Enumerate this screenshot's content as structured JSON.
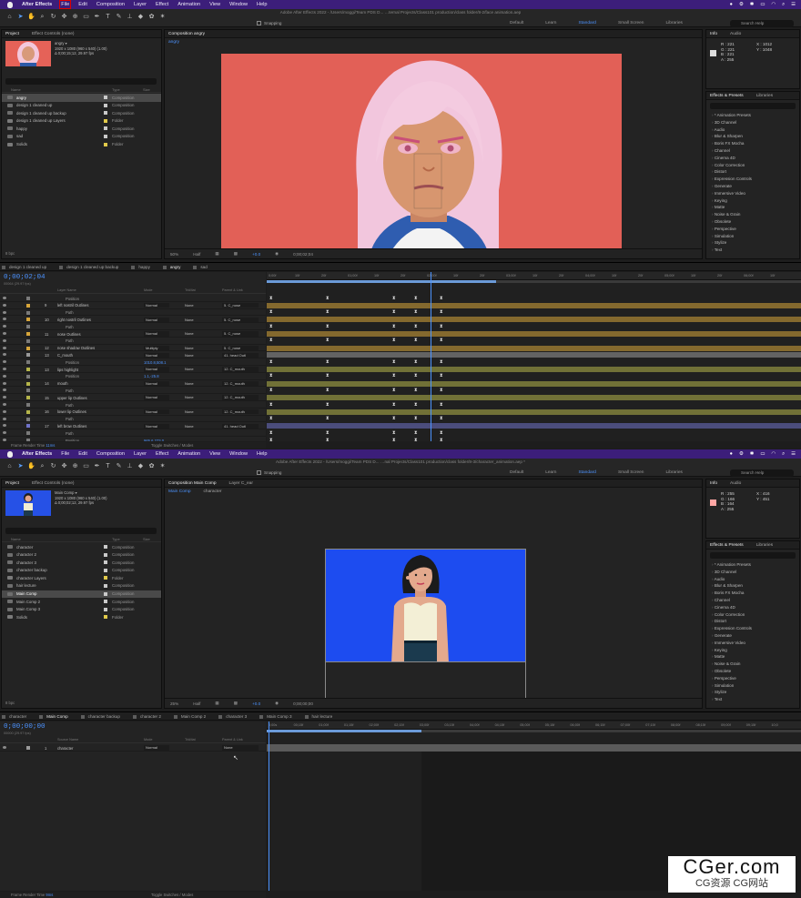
{
  "window1": {
    "menu": [
      "After Effects",
      "File",
      "Edit",
      "Composition",
      "Layer",
      "Effect",
      "Animation",
      "View",
      "Window",
      "Help"
    ],
    "title": "Adobe After Effects 2022 - /Users/moggi/Team PDS D... …ternal Projects/Class101 production/class folder/8-2/face animation.aep",
    "snapping": "Snapping",
    "workspaces": [
      "Default",
      "Learn",
      "Standard",
      "Small Screen",
      "Libraries"
    ],
    "search_help": "Search Help",
    "project_tabs": [
      "Project",
      "Effect Controls (none)"
    ],
    "project_meta": [
      "angry ▾",
      "1920 x 1080  (960 x 540) (1.00)",
      "Δ 0;00;15;12, 29.97 fps"
    ],
    "project_cols": [
      "Name",
      "Type",
      "Size"
    ],
    "project_items": [
      {
        "name": "angry",
        "type": "Composition",
        "color": "#c9c9c9",
        "folder": false,
        "selected": true
      },
      {
        "name": "design 1 cleaned up",
        "type": "Composition",
        "color": "#c9c9c9",
        "folder": false,
        "selected": false
      },
      {
        "name": "design 1 cleaned up backup",
        "type": "Composition",
        "color": "#c9c9c9",
        "folder": false,
        "selected": false
      },
      {
        "name": "design 1 cleaned up Layers",
        "type": "Folder",
        "color": "#e0c94a",
        "folder": true,
        "selected": false
      },
      {
        "name": "happy",
        "type": "Composition",
        "color": "#c9c9c9",
        "folder": false,
        "selected": false
      },
      {
        "name": "sad",
        "type": "Composition",
        "color": "#c9c9c9",
        "folder": false,
        "selected": false
      },
      {
        "name": "Solids",
        "type": "Folder",
        "color": "#e0c94a",
        "folder": true,
        "selected": false
      }
    ],
    "project_footer": "8 bpc",
    "comp_tab": "Composition angry",
    "comp_subtab": "angry",
    "viewer_bar": [
      "50%",
      "Half",
      "+0.0",
      "0;00;02;04"
    ],
    "info_tabs": [
      "Info",
      "Audio"
    ],
    "info_rgb": [
      "R : 221",
      "G : 221",
      "B : 221",
      "A : 255"
    ],
    "info_xy": [
      "X : 1012",
      "Y : 1048"
    ],
    "info_swatch": "#dddddd",
    "effects_tabs": [
      "Effects & Presets",
      "Libraries"
    ],
    "effects": [
      "* Animation Presets",
      "3D Channel",
      "Audio",
      "Blur & Sharpen",
      "Boris FX Mocha",
      "Channel",
      "Cinema 4D",
      "Color Correction",
      "Distort",
      "Expression Controls",
      "Generate",
      "Immersive Video",
      "Keying",
      "Matte",
      "Noise & Grain",
      "Obsolete",
      "Perspective",
      "Simulation",
      "Stylize",
      "Text"
    ],
    "timeline_tabs": [
      "design 1 cleaned up",
      "design 1 cleaned up backup",
      "happy",
      "angry",
      "sad"
    ],
    "timeline_active": "angry",
    "timecode": "0;00;02;04",
    "timecode_sub": "00064 (29.97 fps)",
    "layer_cols": [
      "Layer Name",
      "Mode",
      "TrkMat",
      "Parent & Link"
    ],
    "layers": [
      {
        "num": "",
        "name": "Position",
        "mode": "",
        "trk": "",
        "parent": "",
        "sub": true,
        "val": "",
        "color": "#7a7a7a"
      },
      {
        "num": "9",
        "name": "left nostril Outlines",
        "mode": "Normal",
        "trk": "None",
        "parent": "5. C_nose",
        "sub": false,
        "val": "",
        "color": "#d7a53a"
      },
      {
        "num": "",
        "name": "Path",
        "mode": "",
        "trk": "",
        "parent": "",
        "sub": true,
        "val": "",
        "color": "#7a7a7a"
      },
      {
        "num": "10",
        "name": "right nostril Outlines",
        "mode": "Normal",
        "trk": "None",
        "parent": "5. C_nose",
        "sub": false,
        "val": "",
        "color": "#d7a53a"
      },
      {
        "num": "",
        "name": "Path",
        "mode": "",
        "trk": "",
        "parent": "",
        "sub": true,
        "val": "",
        "color": "#7a7a7a"
      },
      {
        "num": "11",
        "name": "nose Outlines",
        "mode": "Normal",
        "trk": "None",
        "parent": "5. C_nose",
        "sub": false,
        "val": "",
        "color": "#d7a53a"
      },
      {
        "num": "",
        "name": "Path",
        "mode": "",
        "trk": "",
        "parent": "",
        "sub": true,
        "val": "",
        "color": "#7a7a7a"
      },
      {
        "num": "12",
        "name": "nose shadow Outlines",
        "mode": "Multiply",
        "trk": "None",
        "parent": "5. C_nose",
        "sub": false,
        "val": "",
        "color": "#d7a53a"
      },
      {
        "num": "13",
        "name": "C_mouth",
        "mode": "Normal",
        "trk": "None",
        "parent": "41. head Outl",
        "sub": false,
        "val": "",
        "color": "#9a9a9a"
      },
      {
        "num": "",
        "name": "Position",
        "mode": "",
        "trk": "",
        "parent": "",
        "sub": true,
        "val": "1010.8,508.1",
        "color": "#7a7a7a"
      },
      {
        "num": "13",
        "name": "lips highlight",
        "mode": "Normal",
        "trk": "None",
        "parent": "12. C_mouth",
        "sub": false,
        "val": "",
        "color": "#b5b54a"
      },
      {
        "num": "",
        "name": "Position",
        "mode": "",
        "trk": "",
        "parent": "",
        "sub": true,
        "val": "1.1,-25.8",
        "color": "#7a7a7a"
      },
      {
        "num": "14",
        "name": "mouth",
        "mode": "Normal",
        "trk": "None",
        "parent": "12. C_mouth",
        "sub": false,
        "val": "",
        "color": "#b5b54a"
      },
      {
        "num": "",
        "name": "Path",
        "mode": "",
        "trk": "",
        "parent": "",
        "sub": true,
        "val": "",
        "color": "#7a7a7a"
      },
      {
        "num": "15",
        "name": "upper lip Outlines",
        "mode": "Normal",
        "trk": "None",
        "parent": "12. C_mouth",
        "sub": false,
        "val": "",
        "color": "#b5b54a"
      },
      {
        "num": "",
        "name": "Path",
        "mode": "",
        "trk": "",
        "parent": "",
        "sub": true,
        "val": "",
        "color": "#7a7a7a"
      },
      {
        "num": "16",
        "name": "lower lip Outlines",
        "mode": "Normal",
        "trk": "None",
        "parent": "12. C_mouth",
        "sub": false,
        "val": "",
        "color": "#b5b54a"
      },
      {
        "num": "",
        "name": "Path",
        "mode": "",
        "trk": "",
        "parent": "",
        "sub": true,
        "val": "",
        "color": "#7a7a7a"
      },
      {
        "num": "17",
        "name": "left brow Outlines",
        "mode": "Normal",
        "trk": "None",
        "parent": "41. head Outl",
        "sub": false,
        "val": "",
        "color": "#6f72c8"
      },
      {
        "num": "",
        "name": "Path",
        "mode": "",
        "trk": "",
        "parent": "",
        "sub": true,
        "val": "",
        "color": "#7a7a7a"
      },
      {
        "num": "",
        "name": "Position",
        "mode": "",
        "trk": "",
        "parent": "",
        "sub": true,
        "val": "965.6,273.0",
        "color": "#7a7a7a"
      }
    ],
    "ruler": [
      "0;00f",
      "10f",
      "20f",
      "01;00f",
      "10f",
      "20f",
      "02;00f",
      "10f",
      "20f",
      "03;00f",
      "10f",
      "20f",
      "04;00f",
      "10f",
      "20f",
      "05;00f",
      "10f",
      "20f",
      "06;00f",
      "10f"
    ],
    "render_time": "Frame Render Time",
    "render_val": "11ms",
    "toggle": "Toggle Switches / Modes"
  },
  "window2": {
    "menu": [
      "After Effects",
      "File",
      "Edit",
      "Composition",
      "Layer",
      "Effect",
      "Animation",
      "View",
      "Window",
      "Help"
    ],
    "title": "Adobe After Effects 2022 - /Users/moggi/Team PDS D... …nal Projects/Class101 production/class folder/8-3/character_animation.aep *",
    "snapping": "Snapping",
    "workspaces": [
      "Default",
      "Learn",
      "Standard",
      "Small Screen",
      "Libraries"
    ],
    "search_help": "Search Help",
    "project_tabs": [
      "Project",
      "Effect Controls (none)"
    ],
    "project_meta": [
      "Main Comp ▾",
      "1920 x 1080  (960 x 540) (1.00)",
      "Δ 0;00;02;12, 29.97 fps"
    ],
    "project_cols": [
      "Name",
      "Type",
      "Size"
    ],
    "project_items": [
      {
        "name": "character",
        "type": "Composition",
        "color": "#c9c9c9",
        "folder": false,
        "selected": false
      },
      {
        "name": "character 2",
        "type": "Composition",
        "color": "#c9c9c9",
        "folder": false,
        "selected": false
      },
      {
        "name": "character 3",
        "type": "Composition",
        "color": "#c9c9c9",
        "folder": false,
        "selected": false
      },
      {
        "name": "character backup",
        "type": "Composition",
        "color": "#c9c9c9",
        "folder": false,
        "selected": false
      },
      {
        "name": "character Layers",
        "type": "Folder",
        "color": "#e0c94a",
        "folder": true,
        "selected": false
      },
      {
        "name": "hair lecture",
        "type": "Composition",
        "color": "#c9c9c9",
        "folder": false,
        "selected": false
      },
      {
        "name": "Main Comp",
        "type": "Composition",
        "color": "#c9c9c9",
        "folder": false,
        "selected": true
      },
      {
        "name": "Main Comp 2",
        "type": "Composition",
        "color": "#c9c9c9",
        "folder": false,
        "selected": false
      },
      {
        "name": "Main Comp 3",
        "type": "Composition",
        "color": "#c9c9c9",
        "folder": false,
        "selected": false
      },
      {
        "name": "Solids",
        "type": "Folder",
        "color": "#e0c94a",
        "folder": true,
        "selected": false
      }
    ],
    "project_footer": "8 bpc",
    "comp_tab": "Composition Main Comp",
    "layer_tab": "Layer C_ear",
    "comp_subtabs": [
      "Main Comp",
      "character"
    ],
    "viewer_bar": [
      "25%",
      "Half",
      "+0.0",
      "0;00;00;00"
    ],
    "info_tabs": [
      "Info",
      "Audio"
    ],
    "info_rgb": [
      "R : 255",
      "G : 166",
      "B : 164",
      "A : 255"
    ],
    "info_xy": [
      "X : 416",
      "Y : 451"
    ],
    "info_swatch": "#ffa6a4",
    "effects_tabs": [
      "Effects & Presets",
      "Libraries"
    ],
    "effects": [
      "* Animation Presets",
      "3D Channel",
      "Audio",
      "Blur & Sharpen",
      "Boris FX Mocha",
      "Channel",
      "Cinema 4D",
      "Color Correction",
      "Distort",
      "Expression Controls",
      "Generate",
      "Immersive Video",
      "Keying",
      "Matte",
      "Noise & Grain",
      "Obsolete",
      "Perspective",
      "Simulation",
      "Stylize",
      "Text"
    ],
    "timeline_tabs": [
      "character",
      "Main Comp",
      "character backup",
      "character 2",
      "Main Comp 2",
      "character 3",
      "Main Comp 3",
      "hair lecture"
    ],
    "timeline_active": "Main Comp",
    "timecode": "0;00;00;00",
    "timecode_sub": "00000 (29.97 fps)",
    "layer_cols": [
      "Source Name",
      "Mode",
      "TrkMat",
      "Parent & Link"
    ],
    "layers": [
      {
        "num": "1",
        "name": "character",
        "mode": "Normal",
        "trk": "",
        "parent": "None",
        "sub": false,
        "val": "",
        "color": "#9a9a9a"
      }
    ],
    "ruler": [
      "0;00s",
      "00;15f",
      "01;00f",
      "01;15f",
      "02;00f",
      "02;15f",
      "03;00f",
      "03;15f",
      "04;00f",
      "04;15f",
      "05;00f",
      "05;15f",
      "06;00f",
      "06;15f",
      "07;00f",
      "07;15f",
      "08;00f",
      "08;15f",
      "09;00f",
      "09;15f",
      "10;0"
    ],
    "render_time": "Frame Render Time",
    "render_val": "9ms",
    "toggle": "Toggle Switches / Modes"
  },
  "watermark": {
    "line1": "CGer.com",
    "line2": "CG资源 CG网站"
  }
}
